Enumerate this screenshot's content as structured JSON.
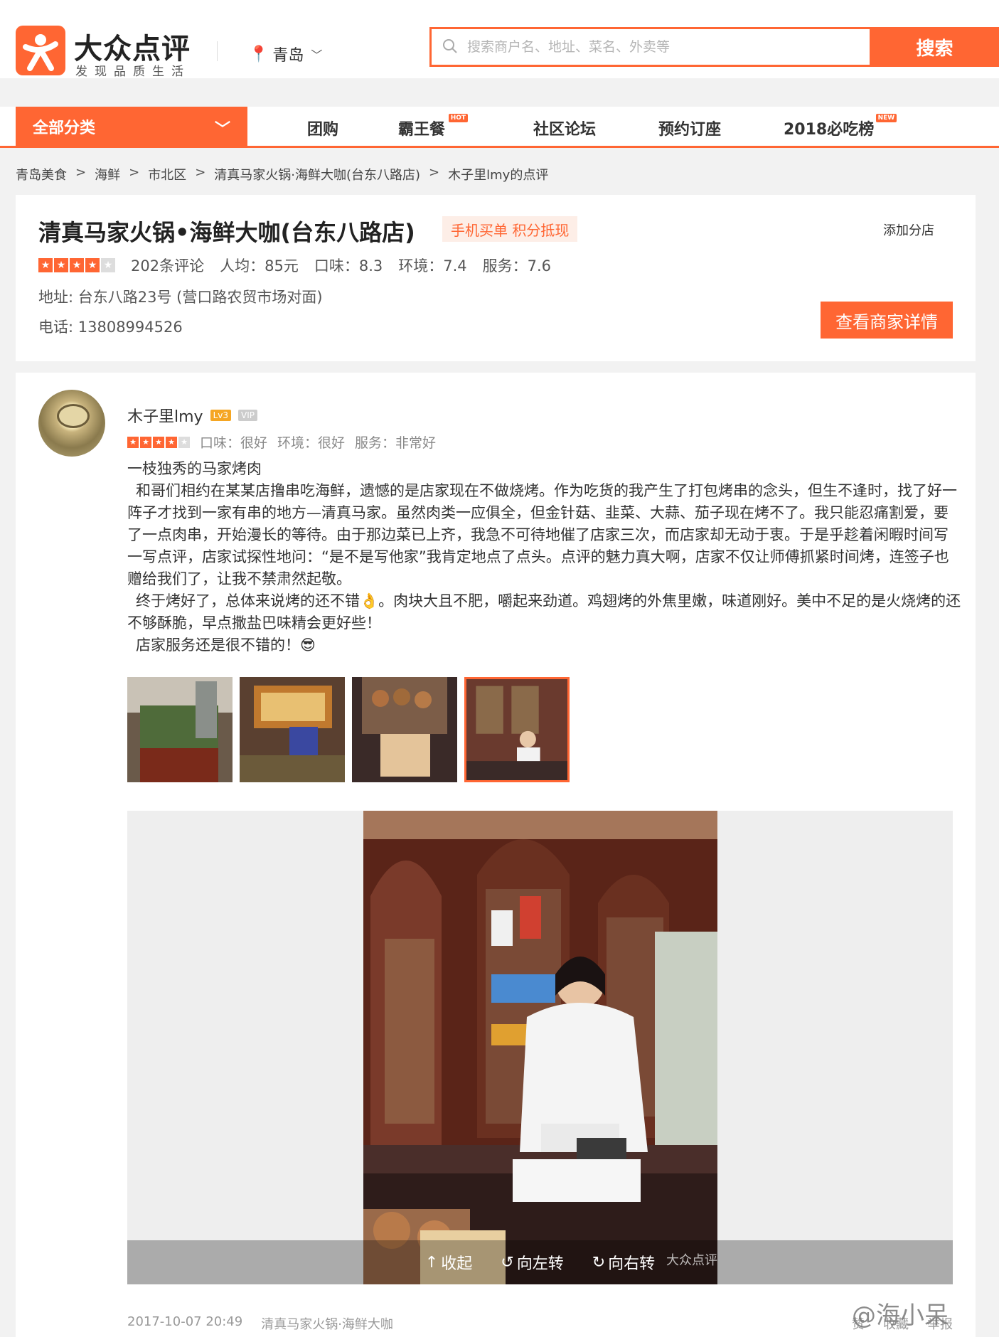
{
  "header": {
    "logo_text": "大众点评",
    "slogan": "发现品质生活",
    "city": "青岛",
    "search_placeholder": "搜索商户名、地址、菜名、外卖等",
    "search_button": "搜索"
  },
  "nav": {
    "all_categories": "全部分类",
    "items": [
      {
        "label": "团购",
        "badge": ""
      },
      {
        "label": "霸王餐",
        "badge": "HOT"
      },
      {
        "label": "社区论坛",
        "badge": ""
      },
      {
        "label": "预约订座",
        "badge": ""
      },
      {
        "label": "2018必吃榜",
        "badge": "NEW"
      }
    ]
  },
  "breadcrumb": [
    "青岛美食",
    "海鲜",
    "市北区",
    "清真马家火锅·海鲜大咖(台东八路店)",
    "木子里lmy的点评"
  ],
  "breadcrumb_sep": ">",
  "shop": {
    "name": "清真马家火锅•海鲜大咖(台东八路店)",
    "tag": "手机买单 积分抵现",
    "add_branch": "添加分店",
    "rating_stars": 4,
    "reviews": "202条评论",
    "avg_price": "人均：85元",
    "taste": "口味：8.3",
    "environment": "环境：7.4",
    "service": "服务：7.6",
    "address": "地址: 台东八路23号 (营口路农贸市场对面)",
    "phone": "电话: 13808994526",
    "detail_button": "查看商家详情"
  },
  "review": {
    "user": "木子里lmy",
    "level": "Lv3",
    "vip": "VIP",
    "rating_stars": 4,
    "scores": [
      "口味：很好",
      "环境：很好",
      "服务：非常好"
    ],
    "title": "一枝独秀的马家烤肉",
    "para1": "和哥们相约在某某店撸串吃海鲜，遗憾的是店家现在不做烧烤。作为吃货的我产生了打包烤串的念头，但生不逢时，找了好一阵子才找到一家有串的地方—清真马家。虽然肉类一应俱全，但金针菇、韭菜、大蒜、茄子现在烤不了。我只能忍痛割爱，要了一点肉串，开始漫长的等待。由于那边菜已上齐，我急不可待地催了店家三次，而店家却无动于衷。于是乎趁着闲暇时间写一写点评，店家试探性地问：“是不是写他家”我肯定地点了点头。点评的魅力真大啊，店家不仅让师傅抓紧时间烤，连签子也赠给我们了，让我不禁肃然起敬。",
    "para2": "终于烤好了，总体来说烤的还不错👌。肉块大且不肥，嚼起来劲道。鸡翅烤的外焦里嫩，味道刚好。美中不足的是火烧烤的还不够酥脆，早点撒盐巴味精会更好些！",
    "para3": "店家服务还是很不错的！😎",
    "photo_controls": [
      "收起",
      "向左转",
      "向右转"
    ],
    "photo_watermark": "大众点评",
    "date": "2017-10-07 20:49",
    "shop_short": "清真马家火锅·海鲜大咖",
    "actions": [
      "赞",
      "收藏",
      "举报"
    ]
  },
  "overlay_watermark": "@海小呆",
  "colors": {
    "accent": "#ff6633",
    "tag_bg": "#fdeee7"
  }
}
